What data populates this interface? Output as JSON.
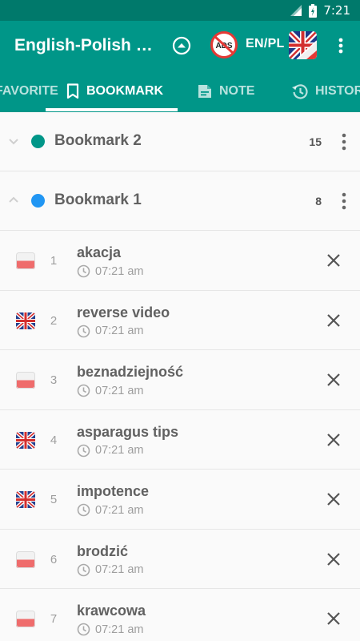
{
  "status_bar": {
    "time": "7:21"
  },
  "app_bar": {
    "title": "English-Polish dictionary",
    "ads_label": "ADS",
    "lang_label": "EN/PL",
    "icons": {
      "collapse": "chevron-up-circle-icon",
      "ads": "no-ads-icon",
      "flag": "uk-poland-flag-icon",
      "menu": "more-vert-icon"
    }
  },
  "tabs": [
    {
      "label": "FAVORITE",
      "icon": "star-icon",
      "active": false
    },
    {
      "label": "BOOKMARK",
      "icon": "bookmark-icon",
      "active": true
    },
    {
      "label": "NOTE",
      "icon": "note-icon",
      "active": false
    },
    {
      "label": "HISTORY",
      "icon": "history-icon",
      "active": false
    }
  ],
  "groups": [
    {
      "name": "Bookmark 2",
      "count": "15",
      "color": "#009688",
      "expanded": false
    },
    {
      "name": "Bookmark 1",
      "count": "8",
      "color": "#2196f3",
      "expanded": true
    }
  ],
  "items": [
    {
      "num": "1",
      "word": "akacja",
      "time": "07:21 am",
      "lang": "pl"
    },
    {
      "num": "2",
      "word": "reverse video",
      "time": "07:21 am",
      "lang": "en"
    },
    {
      "num": "3",
      "word": "beznadziejność",
      "time": "07:21 am",
      "lang": "pl"
    },
    {
      "num": "4",
      "word": "asparagus tips",
      "time": "07:21 am",
      "lang": "en"
    },
    {
      "num": "5",
      "word": "impotence",
      "time": "07:21 am",
      "lang": "en"
    },
    {
      "num": "6",
      "word": "brodzić",
      "time": "07:21 am",
      "lang": "pl"
    },
    {
      "num": "7",
      "word": "krawcowa",
      "time": "07:21 am",
      "lang": "pl"
    }
  ],
  "colors": {
    "primary": "#009688",
    "primary_dark": "#00796b",
    "text": "#616161",
    "muted": "#9e9e9e"
  }
}
